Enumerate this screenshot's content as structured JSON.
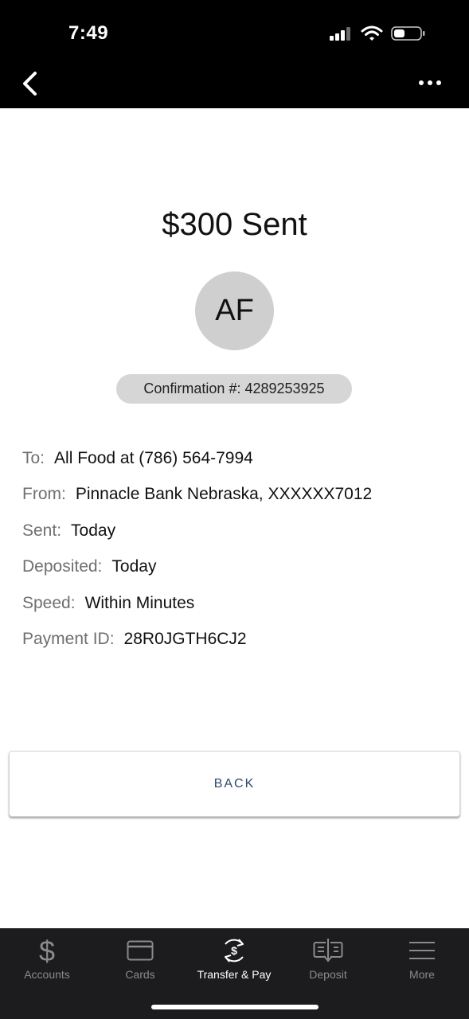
{
  "status_bar": {
    "time": "7:49"
  },
  "header": {
    "back_icon": "chevron-left-icon",
    "more_icon": "more-horizontal-icon"
  },
  "receipt": {
    "title": "$300 Sent",
    "avatar_initials": "AF",
    "confirmation": "Confirmation #: 4289253925",
    "details": [
      {
        "label": "To:",
        "value": "All Food at (786) 564-7994"
      },
      {
        "label": "From:",
        "value": "Pinnacle Bank Nebraska, XXXXXX7012"
      },
      {
        "label": "Sent:",
        "value": "Today"
      },
      {
        "label": "Deposited:",
        "value": "Today"
      },
      {
        "label": "Speed:",
        "value": "Within Minutes"
      },
      {
        "label": "Payment ID:",
        "value": "28R0JGTH6CJ2"
      }
    ],
    "back_button_label": "BACK"
  },
  "tab_bar": {
    "active_tab": "Transfer & Pay",
    "tabs": [
      {
        "label": "Accounts",
        "icon": "dollar-icon"
      },
      {
        "label": "Cards",
        "icon": "card-icon"
      },
      {
        "label": "Transfer & Pay",
        "icon": "transfer-pay-icon"
      },
      {
        "label": "Deposit",
        "icon": "check-deposit-icon"
      },
      {
        "label": "More",
        "icon": "menu-icon"
      }
    ]
  },
  "colors": {
    "header_bg": "#000000",
    "tab_bar_bg": "#1c1c1e",
    "button_text": "#2d4a6e",
    "label_gray": "#6f6f6f",
    "pill_bg": "#d6d6d6",
    "avatar_bg": "#cfcfcf"
  }
}
